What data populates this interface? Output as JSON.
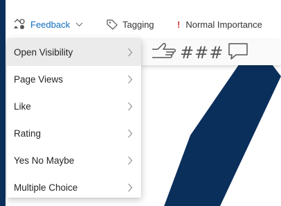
{
  "toolbar": {
    "feedback_label": "Feedback",
    "tagging_label": "Tagging",
    "importance_mark": "!",
    "importance_label": "Normal Importance"
  },
  "menu": {
    "items": [
      {
        "label": "Open Visibility",
        "active": true
      },
      {
        "label": "Page Views"
      },
      {
        "label": "Like"
      },
      {
        "label": "Rating"
      },
      {
        "label": "Yes No Maybe"
      },
      {
        "label": "Multiple Choice"
      }
    ]
  },
  "submenu": {
    "hash_text": "###",
    "icons": [
      "thumbs-up-icon",
      "comment-icon"
    ]
  },
  "colors": {
    "frame": "#0b2f5b",
    "accent": "#0f6cbd",
    "importance": "#d13438"
  }
}
